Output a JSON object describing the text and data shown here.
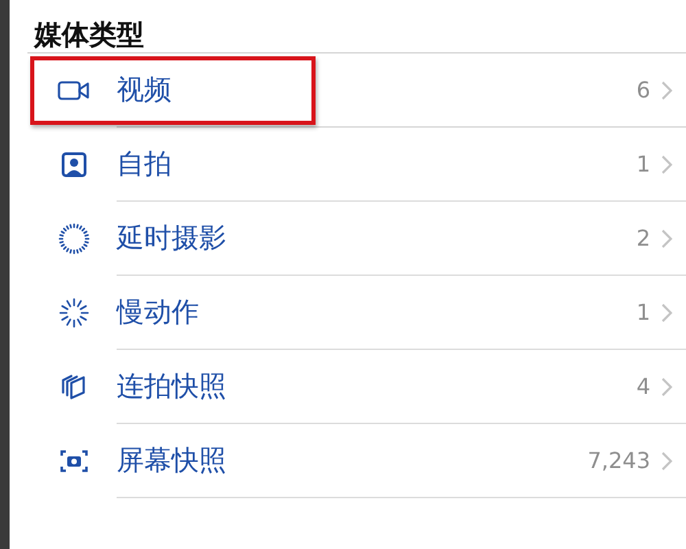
{
  "section": {
    "title": "媒体类型"
  },
  "items": [
    {
      "kind": "video",
      "label": "视频",
      "count": "6",
      "highlighted": true
    },
    {
      "kind": "selfie",
      "label": "自拍",
      "count": "1",
      "highlighted": false
    },
    {
      "kind": "timelapse",
      "label": "延时摄影",
      "count": "2",
      "highlighted": false
    },
    {
      "kind": "slowmo",
      "label": "慢动作",
      "count": "1",
      "highlighted": false
    },
    {
      "kind": "burst",
      "label": "连拍快照",
      "count": "4",
      "highlighted": false
    },
    {
      "kind": "screenshot",
      "label": "屏幕快照",
      "count": "7,243",
      "highlighted": false
    }
  ]
}
